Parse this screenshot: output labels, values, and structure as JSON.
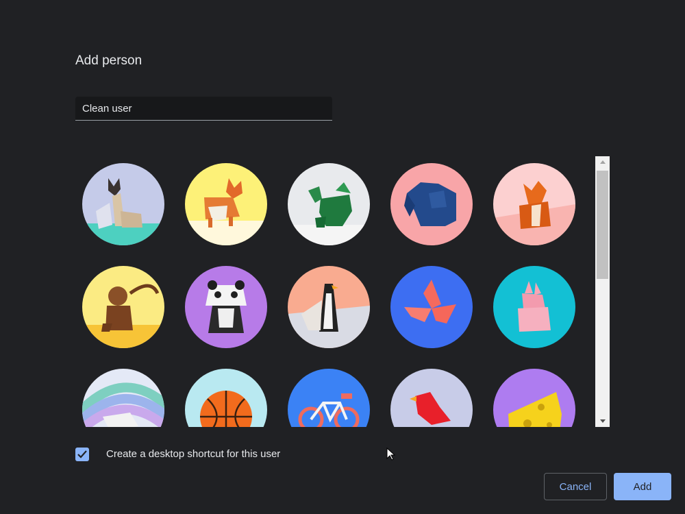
{
  "dialog": {
    "title": "Add person",
    "name_input": {
      "value": "Clean user",
      "placeholder": ""
    },
    "avatars": [
      {
        "name": "cat-avatar",
        "bg": "#c5cbe9"
      },
      {
        "name": "corgi-avatar",
        "bg": "#fdf178"
      },
      {
        "name": "dragon-avatar",
        "bg": "#e8eaed"
      },
      {
        "name": "elephant-avatar",
        "bg": "#f8a5a8"
      },
      {
        "name": "fox-avatar",
        "bg": "#fcd0d0"
      },
      {
        "name": "monkey-avatar",
        "bg": "#fbeb83"
      },
      {
        "name": "panda-avatar",
        "bg": "#b77be8"
      },
      {
        "name": "penguin-avatar",
        "bg": "#f9ab90"
      },
      {
        "name": "butterfly-avatar",
        "bg": "#3d6ef2"
      },
      {
        "name": "rabbit-avatar",
        "bg": "#13c0d4"
      },
      {
        "name": "unicorn-avatar",
        "bg": "#e4e9f6"
      },
      {
        "name": "basketball-avatar",
        "bg": "#b9e9f1"
      },
      {
        "name": "bike-avatar",
        "bg": "#3b82f5"
      },
      {
        "name": "bird-avatar",
        "bg": "#c8cce8"
      },
      {
        "name": "cheese-avatar",
        "bg": "#ae7cf0"
      }
    ],
    "shortcut_checkbox": {
      "checked": true,
      "label": "Create a desktop shortcut for this user"
    },
    "buttons": {
      "cancel": "Cancel",
      "add": "Add"
    },
    "colors": {
      "background": "#202124",
      "accent": "#8ab4f8",
      "text": "#e8eaed"
    }
  }
}
